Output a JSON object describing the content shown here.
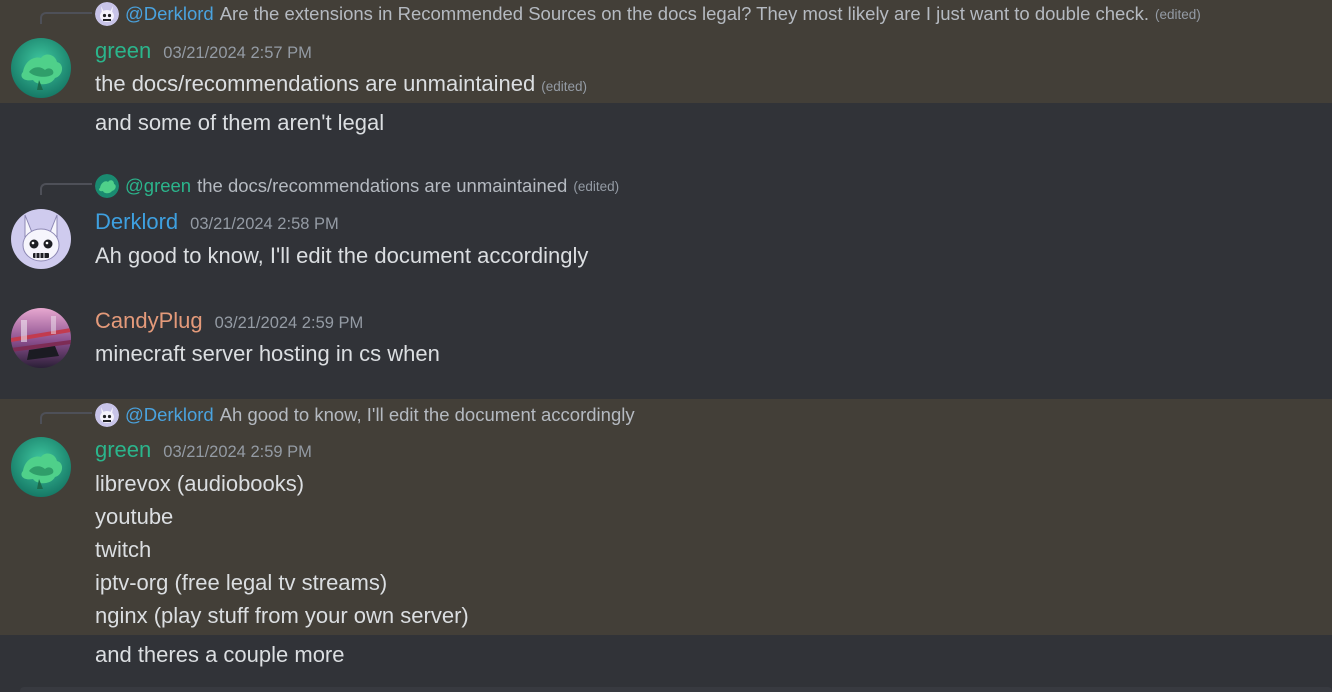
{
  "colors": {
    "background": "#313338",
    "highlight": "#433f38",
    "green_user": "#2bb58c",
    "derklord_user": "#3ea0e0",
    "candyplug_user": "#e49a7a",
    "mention": "#4aa3df",
    "text": "#dbdee1",
    "muted": "#949ba4"
  },
  "edited_label": "(edited)",
  "messages": [
    {
      "reply": {
        "mention": "@Derklord",
        "text": "Are the extensions in Recommended Sources on the docs legal? They most likely are I just want to double check.",
        "edited": "(edited)"
      },
      "author": "green",
      "timestamp": "03/21/2024 2:57 PM",
      "lines": [
        "the docs/recommendations are unmaintained",
        "and some of them aren't legal"
      ],
      "edited": "(edited)"
    },
    {
      "reply": {
        "mention": "@green",
        "text": "the docs/recommendations are unmaintained",
        "edited": "(edited)"
      },
      "author": "Derklord",
      "timestamp": "03/21/2024 2:58 PM",
      "lines": [
        "Ah good to know, I'll edit the document accordingly"
      ]
    },
    {
      "author": "CandyPlug",
      "timestamp": "03/21/2024 2:59 PM",
      "lines": [
        "minecraft server hosting in cs when"
      ]
    },
    {
      "reply": {
        "mention": "@Derklord",
        "text": "Ah good to know, I'll edit the document accordingly"
      },
      "author": "green",
      "timestamp": "03/21/2024 2:59 PM",
      "lines": [
        "librevox (audiobooks)",
        "youtube",
        "twitch",
        "iptv-org (free legal tv streams)",
        "nginx (play stuff from your own server)",
        "and theres a couple more"
      ]
    }
  ]
}
